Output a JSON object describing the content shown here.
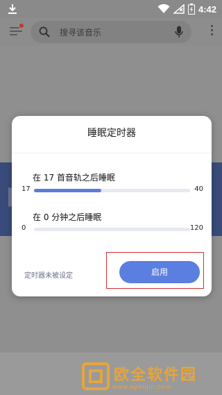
{
  "status_bar": {
    "time": "4:42"
  },
  "search": {
    "placeholder": "搜寻该音乐"
  },
  "dialog": {
    "title": "睡眠定时器",
    "track_timer": {
      "label": "在 17 首音轨之后睡眠",
      "min": "17",
      "max": "40",
      "value": 17,
      "range": [
        17,
        40
      ],
      "fill_fraction": 0.43
    },
    "minute_timer": {
      "label": "在 0 分钟之后睡眠",
      "min": "0",
      "max": "120",
      "value": 0,
      "range": [
        0,
        120
      ],
      "fill_fraction": 0
    },
    "status": "定时器未被设定",
    "enable_label": "启用"
  },
  "watermark": {
    "text": "欧全软件园",
    "url": "www.apoujin.com"
  },
  "colors": {
    "accent": "#5b7fe0",
    "highlight_box": "#d32f2f",
    "watermark": "#e7a53a"
  }
}
